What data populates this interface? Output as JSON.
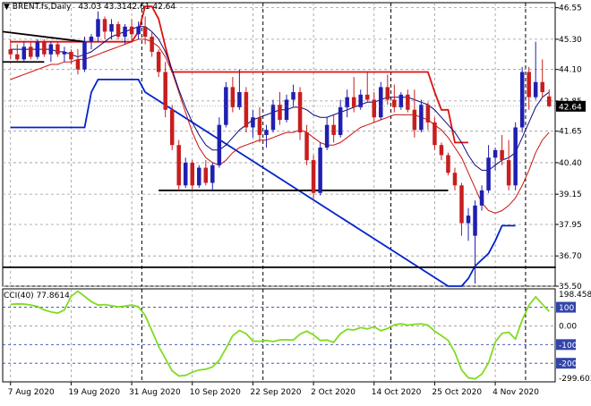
{
  "header": {
    "symbol_marker": "▼",
    "symbol": "BRENT.fs,Daily",
    "open": "43.03",
    "high": "43.31",
    "low": "42.61",
    "close": "42.64"
  },
  "cci_header": {
    "label": "CCI(40)",
    "value": "77.8614"
  },
  "colors": {
    "bull_candle": "#1f1fb0",
    "bear_candle": "#c81e1e",
    "ma_fast": "#0a0a80",
    "ma_slow": "#cc1111",
    "channel_upper": "#dd1111",
    "channel_lower": "#0022cc",
    "cci_line": "#7fdc1e",
    "level_line": "#000000",
    "cci_level": "#3344aa"
  },
  "chart_data": [
    {
      "type": "candlestick",
      "name": "price",
      "ylim": [
        35.5,
        46.75
      ],
      "y_ticks": [
        "46.55",
        "45.30",
        "44.10",
        "42.85",
        "41.65",
        "40.40",
        "39.15",
        "37.95",
        "36.70",
        "35.50"
      ],
      "current_price_label": "42.64",
      "x_tick_labels": [
        "7 Aug 2020",
        "19 Aug 2020",
        "31 Aug 2020",
        "10 Sep 2020",
        "22 Sep 2020",
        "2 Oct 2020",
        "14 Oct 2020",
        "25 Oct 2020",
        "4 Nov 2020"
      ],
      "x_tick_index": [
        0,
        9,
        18,
        27,
        36,
        45,
        54,
        63,
        72
      ],
      "candles": [
        [
          44.9,
          45.3,
          44.5,
          44.7
        ],
        [
          44.7,
          45.1,
          44.4,
          44.5
        ],
        [
          44.5,
          45.2,
          44.4,
          45.0
        ],
        [
          45.0,
          45.2,
          44.5,
          44.6
        ],
        [
          44.6,
          45.3,
          44.5,
          45.2
        ],
        [
          45.2,
          45.3,
          44.6,
          44.7
        ],
        [
          44.7,
          45.2,
          44.4,
          45.1
        ],
        [
          45.1,
          45.2,
          44.6,
          44.7
        ],
        [
          44.7,
          45.0,
          44.4,
          44.8
        ],
        [
          44.8,
          44.9,
          44.3,
          44.5
        ],
        [
          44.5,
          44.9,
          43.9,
          44.1
        ],
        [
          44.1,
          45.4,
          44.0,
          45.2
        ],
        [
          45.2,
          45.5,
          44.9,
          45.4
        ],
        [
          45.4,
          46.4,
          45.2,
          46.1
        ],
        [
          46.1,
          46.2,
          45.3,
          45.6
        ],
        [
          45.6,
          46.1,
          45.3,
          45.9
        ],
        [
          45.9,
          46.0,
          45.3,
          45.4
        ],
        [
          45.4,
          45.9,
          45.1,
          45.8
        ],
        [
          45.8,
          46.1,
          45.2,
          45.5
        ],
        [
          45.5,
          46.0,
          45.3,
          45.8
        ],
        [
          45.8,
          46.2,
          45.1,
          45.4
        ],
        [
          45.4,
          45.6,
          44.6,
          44.8
        ],
        [
          44.8,
          44.9,
          43.8,
          44.0
        ],
        [
          44.0,
          44.4,
          42.2,
          42.5
        ],
        [
          42.5,
          42.7,
          40.9,
          41.1
        ],
        [
          41.1,
          41.3,
          39.3,
          39.5
        ],
        [
          39.5,
          40.6,
          39.4,
          40.4
        ],
        [
          40.4,
          40.5,
          39.3,
          39.5
        ],
        [
          39.5,
          40.3,
          39.4,
          40.2
        ],
        [
          40.2,
          40.5,
          39.5,
          39.6
        ],
        [
          39.6,
          40.4,
          39.3,
          40.3
        ],
        [
          40.3,
          42.2,
          40.2,
          41.9
        ],
        [
          41.9,
          43.6,
          41.8,
          43.4
        ],
        [
          43.4,
          43.8,
          42.4,
          42.6
        ],
        [
          42.6,
          44.1,
          42.5,
          43.2
        ],
        [
          43.2,
          43.4,
          41.6,
          41.8
        ],
        [
          41.8,
          42.5,
          41.4,
          42.2
        ],
        [
          42.2,
          42.6,
          41.2,
          41.5
        ],
        [
          41.5,
          41.9,
          41.0,
          41.7
        ],
        [
          41.7,
          42.9,
          41.6,
          42.7
        ],
        [
          42.7,
          43.2,
          41.9,
          42.1
        ],
        [
          42.1,
          43.1,
          42.0,
          42.9
        ],
        [
          42.9,
          43.5,
          42.6,
          43.2
        ],
        [
          43.2,
          43.4,
          41.3,
          41.6
        ],
        [
          41.6,
          41.9,
          40.3,
          40.5
        ],
        [
          40.5,
          40.7,
          38.9,
          39.2
        ],
        [
          39.2,
          41.2,
          39.1,
          41.0
        ],
        [
          41.0,
          42.2,
          40.9,
          41.9
        ],
        [
          41.9,
          42.3,
          41.2,
          41.5
        ],
        [
          41.5,
          42.9,
          41.4,
          42.6
        ],
        [
          42.6,
          43.3,
          42.2,
          43.0
        ],
        [
          43.0,
          43.8,
          42.4,
          42.6
        ],
        [
          42.6,
          43.3,
          42.5,
          43.1
        ],
        [
          43.1,
          44.0,
          42.8,
          42.9
        ],
        [
          42.9,
          43.2,
          42.0,
          42.2
        ],
        [
          42.2,
          43.6,
          42.1,
          43.4
        ],
        [
          43.4,
          43.9,
          42.7,
          42.9
        ],
        [
          42.9,
          43.5,
          42.4,
          42.6
        ],
        [
          42.6,
          43.2,
          42.5,
          43.1
        ],
        [
          43.1,
          43.3,
          42.4,
          42.5
        ],
        [
          42.5,
          43.3,
          41.4,
          41.7
        ],
        [
          41.7,
          42.9,
          41.6,
          42.7
        ],
        [
          42.7,
          42.8,
          41.7,
          42.0
        ],
        [
          42.0,
          42.2,
          40.9,
          41.1
        ],
        [
          41.1,
          41.2,
          40.5,
          40.7
        ],
        [
          40.7,
          40.8,
          39.9,
          40.0
        ],
        [
          40.0,
          40.2,
          39.3,
          39.5
        ],
        [
          39.5,
          39.6,
          37.5,
          38.0
        ],
        [
          38.0,
          38.6,
          37.3,
          38.3
        ],
        [
          37.5,
          38.9,
          35.6,
          38.7
        ],
        [
          38.7,
          39.5,
          38.5,
          39.3
        ],
        [
          39.3,
          41.1,
          39.2,
          40.6
        ],
        [
          40.6,
          41.0,
          40.1,
          40.9
        ],
        [
          40.9,
          41.5,
          40.3,
          40.5
        ],
        [
          40.5,
          41.3,
          39.3,
          39.5
        ],
        [
          39.5,
          42.0,
          39.3,
          41.8
        ],
        [
          41.8,
          44.2,
          41.6,
          44.0
        ],
        [
          44.0,
          44.2,
          42.5,
          43.0
        ],
        [
          43.0,
          45.2,
          42.9,
          43.6
        ],
        [
          43.6,
          44.5,
          43.0,
          43.2
        ],
        [
          43.03,
          43.31,
          42.61,
          42.64
        ]
      ],
      "ma_fast": [
        44.9,
        44.9,
        44.9,
        44.9,
        44.9,
        44.9,
        44.9,
        44.8,
        44.8,
        44.7,
        44.6,
        44.7,
        44.8,
        45.0,
        45.2,
        45.4,
        45.5,
        45.6,
        45.7,
        45.8,
        45.8,
        45.6,
        45.3,
        44.8,
        44.1,
        43.3,
        42.6,
        42.0,
        41.5,
        41.1,
        40.9,
        40.9,
        41.1,
        41.4,
        41.7,
        41.9,
        42.1,
        42.2,
        42.3,
        42.4,
        42.5,
        42.5,
        42.6,
        42.6,
        42.5,
        42.3,
        42.2,
        42.2,
        42.3,
        42.4,
        42.5,
        42.6,
        42.7,
        42.8,
        42.8,
        42.9,
        43.0,
        43.0,
        43.0,
        43.0,
        42.9,
        42.8,
        42.7,
        42.5,
        42.2,
        41.9,
        41.6,
        41.2,
        40.7,
        40.3,
        40.1,
        40.1,
        40.3,
        40.5,
        40.6,
        40.8,
        41.4,
        42.0,
        42.6,
        43.0,
        43.2
      ],
      "ma_slow": [
        43.7,
        43.8,
        43.9,
        44.0,
        44.1,
        44.2,
        44.3,
        44.3,
        44.4,
        44.4,
        44.5,
        44.5,
        44.6,
        44.7,
        44.8,
        44.9,
        45.0,
        45.1,
        45.2,
        45.3,
        45.3,
        45.2,
        45.0,
        44.6,
        44.0,
        43.2,
        42.4,
        41.6,
        41.0,
        40.6,
        40.4,
        40.3,
        40.5,
        40.8,
        41.0,
        41.1,
        41.2,
        41.3,
        41.3,
        41.4,
        41.5,
        41.6,
        41.6,
        41.7,
        41.6,
        41.4,
        41.2,
        41.1,
        41.1,
        41.2,
        41.4,
        41.6,
        41.8,
        41.9,
        42.0,
        42.1,
        42.2,
        42.3,
        42.3,
        42.3,
        42.3,
        42.2,
        42.1,
        41.9,
        41.7,
        41.4,
        41.0,
        40.6,
        40.0,
        39.4,
        38.8,
        38.5,
        38.4,
        38.5,
        38.7,
        39.0,
        39.5,
        40.1,
        40.8,
        41.3,
        41.6
      ],
      "channel_upper": [
        [
          0,
          45.2
        ],
        [
          18,
          45.2
        ],
        [
          19,
          45.6
        ],
        [
          20,
          46.6
        ],
        [
          21,
          46.6
        ],
        [
          22,
          46.1
        ],
        [
          23,
          45.0
        ],
        [
          24,
          44.0
        ],
        [
          62,
          44.0
        ],
        [
          63,
          43.2
        ],
        [
          64,
          42.5
        ],
        [
          65,
          42.5
        ],
        [
          66,
          41.2
        ],
        [
          68,
          41.2
        ]
      ],
      "channel_lower": [
        [
          0,
          41.8
        ],
        [
          11,
          41.8
        ],
        [
          12,
          43.2
        ],
        [
          13,
          43.7
        ],
        [
          19,
          43.7
        ],
        [
          20,
          43.2
        ],
        [
          65,
          35.5
        ],
        [
          67,
          35.5
        ],
        [
          68,
          35.8
        ],
        [
          69,
          36.3
        ],
        [
          71,
          36.8
        ],
        [
          72,
          37.3
        ],
        [
          73,
          37.9
        ],
        [
          75,
          37.9
        ]
      ],
      "support_lines": [
        {
          "from": 0,
          "to": 11,
          "start": 45.6,
          "end": 45.2
        },
        {
          "from": 0,
          "to": 5,
          "start": 44.4,
          "end": 44.4
        },
        {
          "from": 22,
          "to": 65,
          "start": 39.3,
          "end": 39.3
        },
        {
          "from": 0,
          "to": 81,
          "start": 36.25,
          "end": 36.25
        }
      ],
      "vertical_separators": [
        20,
        38,
        57,
        77
      ]
    },
    {
      "type": "line",
      "name": "CCI(40)",
      "ylim": [
        -299.603,
        198.4581
      ],
      "y_ticks_right": [
        "198.4581",
        "100",
        "0.00",
        "-100",
        "-200",
        "-299.603"
      ],
      "levels": [
        100,
        -100,
        -200
      ],
      "values": [
        115,
        118,
        117,
        112,
        104,
        85,
        75,
        68,
        85,
        158,
        186,
        158,
        130,
        112,
        114,
        108,
        102,
        106,
        112,
        102,
        56,
        -25,
        -110,
        -175,
        -240,
        -268,
        -265,
        -248,
        -236,
        -232,
        -220,
        -184,
        -120,
        -52,
        -24,
        -42,
        -81,
        -82,
        -78,
        -84,
        -75,
        -74,
        -76,
        -44,
        -28,
        -48,
        -78,
        -76,
        -88,
        -42,
        -18,
        -22,
        -9,
        -16,
        -4,
        -26,
        -14,
        6,
        11,
        4,
        9,
        11,
        4,
        -28,
        -52,
        -78,
        -142,
        -236,
        -278,
        -284,
        -258,
        -198,
        -86,
        -40,
        -34,
        -70,
        32,
        110,
        156,
        116,
        77.8614
      ]
    }
  ]
}
